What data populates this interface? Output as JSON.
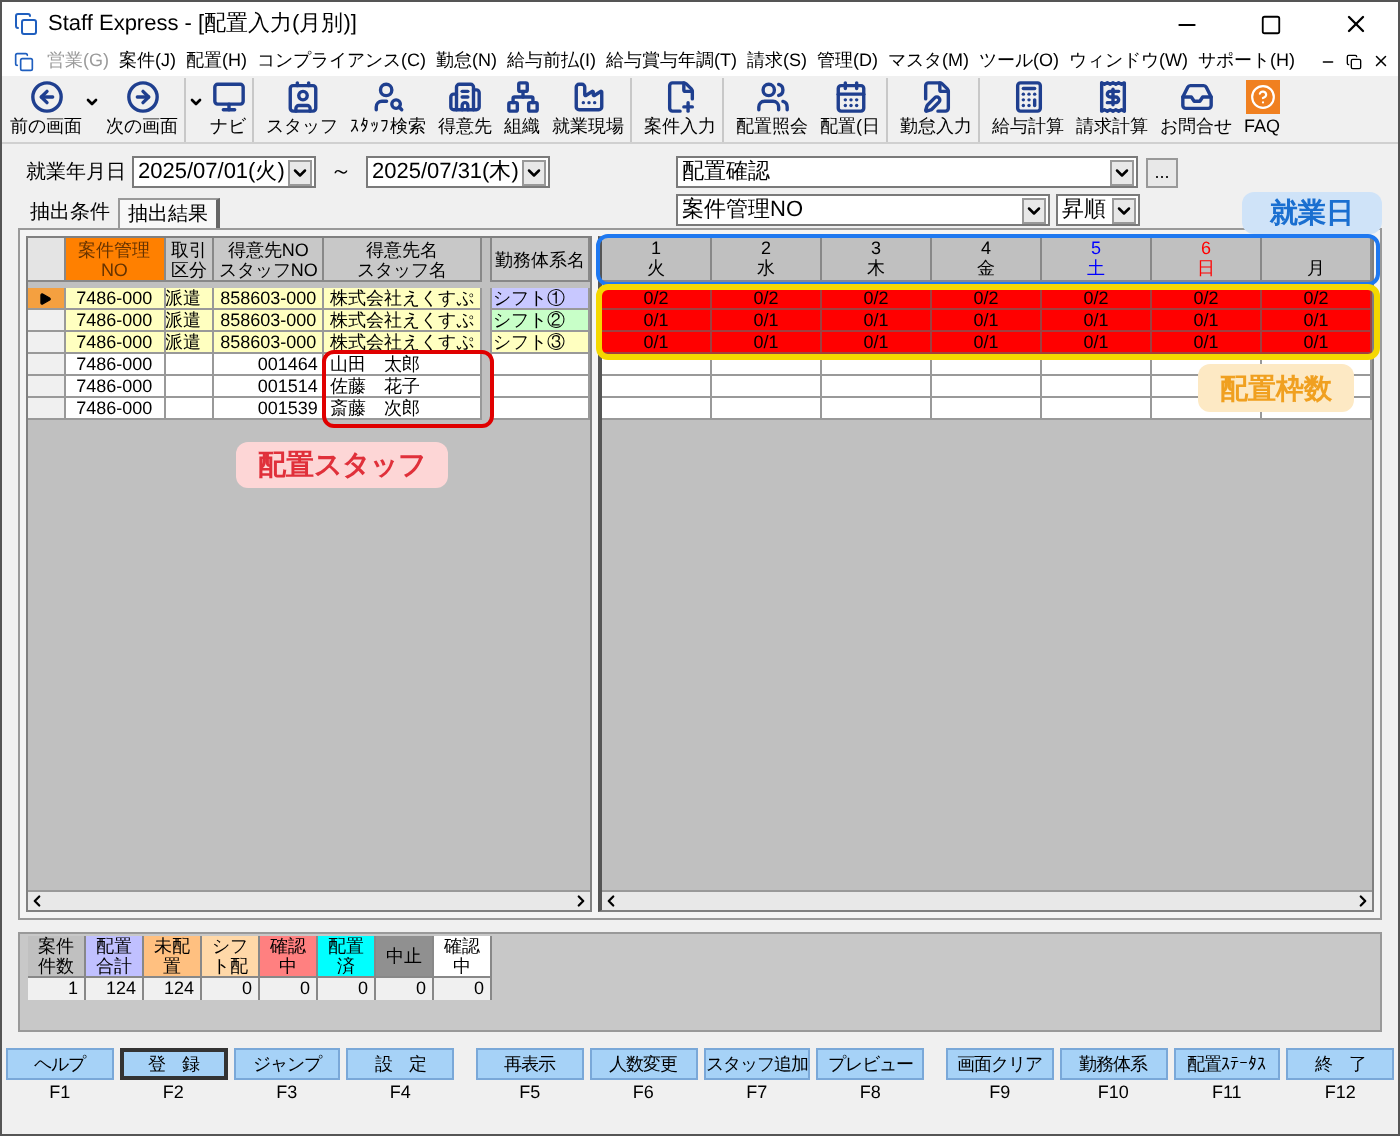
{
  "window": {
    "title": "Staff Express - [配置入力(月別)]"
  },
  "menu": [
    {
      "label": "営業(G)",
      "disabled": true
    },
    {
      "label": "案件(J)",
      "disabled": false
    },
    {
      "label": "配置(H)",
      "disabled": false
    },
    {
      "label": "コンプライアンス(C)",
      "disabled": false
    },
    {
      "label": "勤怠(N)",
      "disabled": false
    },
    {
      "label": "給与前払(I)",
      "disabled": false
    },
    {
      "label": "給与賞与年調(T)",
      "disabled": false
    },
    {
      "label": "請求(S)",
      "disabled": false
    },
    {
      "label": "管理(D)",
      "disabled": false
    },
    {
      "label": "マスタ(M)",
      "disabled": false
    },
    {
      "label": "ツール(O)",
      "disabled": false
    },
    {
      "label": "ウィンドウ(W)",
      "disabled": false
    },
    {
      "label": "サポート(H)",
      "disabled": false
    }
  ],
  "toolbar": [
    {
      "label": "前の画面",
      "has_menu": true,
      "group_end": false
    },
    {
      "label": "次の画面",
      "has_menu": true,
      "group_end": true
    },
    {
      "label": "ナビ",
      "has_menu": false,
      "group_end": true
    },
    {
      "label": "スタッフ",
      "has_menu": false,
      "group_end": false
    },
    {
      "label": "ｽﾀｯﾌ検索",
      "has_menu": false,
      "group_end": false
    },
    {
      "label": "得意先",
      "has_menu": false,
      "group_end": false
    },
    {
      "label": "組織",
      "has_menu": false,
      "group_end": false
    },
    {
      "label": "就業現場",
      "has_menu": false,
      "group_end": true
    },
    {
      "label": "案件入力",
      "has_menu": false,
      "group_end": true
    },
    {
      "label": "配置照会",
      "has_menu": false,
      "group_end": false
    },
    {
      "label": "配置(日",
      "has_menu": false,
      "group_end": true
    },
    {
      "label": "勤怠入力",
      "has_menu": false,
      "group_end": true
    },
    {
      "label": "給与計算",
      "has_menu": false,
      "group_end": false
    },
    {
      "label": "請求計算",
      "has_menu": false,
      "group_end": false
    },
    {
      "label": "お問合せ",
      "has_menu": false,
      "group_end": false
    },
    {
      "label": "FAQ",
      "has_menu": false,
      "group_end": false
    }
  ],
  "period": {
    "label": "就業年月日",
    "from": "2025/07/01(火)",
    "separator": "～",
    "to": "2025/07/31(木)"
  },
  "view_select": {
    "value": "配置確認",
    "button": "..."
  },
  "sort": {
    "field": "案件管理NO",
    "order": "昇順"
  },
  "tabs": [
    {
      "label": "抽出条件",
      "selected": false
    },
    {
      "label": "抽出結果",
      "selected": true
    }
  ],
  "left_columns": [
    {
      "lines": [
        "案件管理",
        "NO"
      ],
      "kind": "key"
    },
    {
      "lines": [
        "取引",
        "区分"
      ],
      "kind": "plain"
    },
    {
      "lines": [
        "得意先NO",
        "スタッフNO"
      ],
      "kind": "plain"
    },
    {
      "lines": [
        "得意先名",
        "スタッフ名"
      ],
      "kind": "plain"
    },
    {
      "lines": [
        "勤務体系名"
      ],
      "kind": "plain"
    }
  ],
  "days": [
    {
      "day": "1",
      "weekday": "火",
      "kind": "weekday"
    },
    {
      "day": "2",
      "weekday": "水",
      "kind": "weekday"
    },
    {
      "day": "3",
      "weekday": "木",
      "kind": "weekday"
    },
    {
      "day": "4",
      "weekday": "金",
      "kind": "weekday"
    },
    {
      "day": "5",
      "weekday": "土",
      "kind": "saturday"
    },
    {
      "day": "6",
      "weekday": "日",
      "kind": "sunday"
    },
    {
      "weekday": "月",
      "kind": "weekday"
    }
  ],
  "rows": [
    {
      "kind": "case",
      "selected": true,
      "case_no": "7486-000",
      "deal": "派遣",
      "number": "858603-000",
      "name": "株式会社えくすぷ",
      "shift": "シフト①",
      "color": "#c8c8ff",
      "slots": [
        "0/2",
        "0/2",
        "0/2",
        "0/2",
        "0/2",
        "0/2",
        "0/2"
      ]
    },
    {
      "kind": "case",
      "selected": false,
      "case_no": "7486-000",
      "deal": "派遣",
      "number": "858603-000",
      "name": "株式会社えくすぷ",
      "shift": "シフト②",
      "color": "#c8ffc8",
      "slots": [
        "0/1",
        "0/1",
        "0/1",
        "0/1",
        "0/1",
        "0/1",
        "0/1"
      ]
    },
    {
      "kind": "case",
      "selected": false,
      "case_no": "7486-000",
      "deal": "派遣",
      "number": "858603-000",
      "name": "株式会社えくすぷ",
      "shift": "シフト③",
      "color": "#ffffc0",
      "slots": [
        "0/1",
        "0/1",
        "0/1",
        "0/1",
        "0/1",
        "0/1",
        "0/1"
      ]
    },
    {
      "kind": "staff",
      "selected": false,
      "case_no": "7486-000",
      "number": "001464",
      "name": "山田　太郎"
    },
    {
      "kind": "staff",
      "selected": false,
      "case_no": "7486-000",
      "number": "001514",
      "name": "佐藤　花子"
    },
    {
      "kind": "staff",
      "selected": false,
      "case_no": "7486-000",
      "number": "001539",
      "name": "斎藤　次郎"
    }
  ],
  "summary": [
    {
      "lines": [
        "案件",
        "件数"
      ],
      "value": "1",
      "color": "#c0c0c0"
    },
    {
      "lines": [
        "配置",
        "合計"
      ],
      "value": "124",
      "color": "#c0c0ff"
    },
    {
      "lines": [
        "未配",
        "置"
      ],
      "value": "124",
      "color": "#ffc080"
    },
    {
      "lines": [
        "シフ",
        "ト配"
      ],
      "value": "0",
      "color": "#ffd8a8"
    },
    {
      "lines": [
        "確認",
        "中"
      ],
      "value": "0",
      "color": "#ff8080"
    },
    {
      "lines": [
        "配置",
        "済"
      ],
      "value": "0",
      "color": "#00ffff"
    },
    {
      "lines": [
        "中止"
      ],
      "value": "0",
      "color": "#909090"
    },
    {
      "lines": [
        "確認",
        "中"
      ],
      "value": "0",
      "color": "#ffffff"
    }
  ],
  "function_keys": [
    {
      "label": "ヘルプ",
      "key": "F1",
      "default": false
    },
    {
      "label": "登　録",
      "key": "F2",
      "default": true
    },
    {
      "label": "ジャンプ",
      "key": "F3",
      "default": false
    },
    {
      "label": "設　定",
      "key": "F4",
      "default": false
    },
    {
      "label": "再表示",
      "key": "F5",
      "default": false
    },
    {
      "label": "人数変更",
      "key": "F6",
      "default": false
    },
    {
      "label": "スタッフ追加",
      "key": "F7",
      "default": false
    },
    {
      "label": "プレビュー",
      "key": "F8",
      "default": false
    },
    {
      "label": "画面クリア",
      "key": "F9",
      "default": false
    },
    {
      "label": "勤務体系",
      "key": "F10",
      "default": false
    },
    {
      "label": "配置ｽﾃｰﾀｽ",
      "key": "F11",
      "default": false
    },
    {
      "label": "終　了",
      "key": "F12",
      "default": false
    }
  ],
  "annotations": [
    {
      "kind": "workday",
      "label": "就業日"
    },
    {
      "kind": "slots",
      "label": "配置枠数"
    },
    {
      "kind": "staff",
      "label": "配置スタッフ"
    }
  ]
}
